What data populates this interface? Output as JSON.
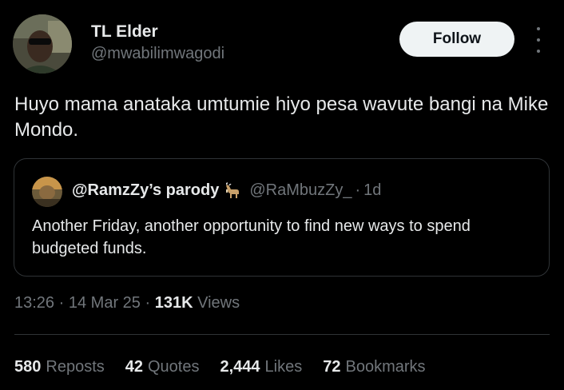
{
  "author": {
    "name": "TL Elder",
    "handle": "@mwabilimwagodi"
  },
  "follow_label": "Follow",
  "tweet_text": "Huyo mama anataka umtumie hiyo pesa wavute bangi na Mike Mondo.",
  "quote": {
    "name": "@RamzZy’s parody",
    "emoji_icon": "goat-icon",
    "handle": "@RaMbuzZy_",
    "dot": "·",
    "time": "1d",
    "text": "Another Friday, another opportunity to find new ways to spend budgeted funds."
  },
  "meta": {
    "time": "13:26",
    "sep1": "·",
    "date": "14 Mar 25",
    "sep2": "·",
    "views_count": "131K",
    "views_label": "Views"
  },
  "stats": [
    {
      "count": "580",
      "label": "Reposts"
    },
    {
      "count": "42",
      "label": "Quotes"
    },
    {
      "count": "2,444",
      "label": "Likes"
    },
    {
      "count": "72",
      "label": "Bookmarks"
    }
  ],
  "colors": {
    "background": "#000000",
    "text_primary": "#e7e9ea",
    "text_secondary": "#71767b",
    "border": "#2f3336",
    "follow_bg": "#eff3f4"
  }
}
